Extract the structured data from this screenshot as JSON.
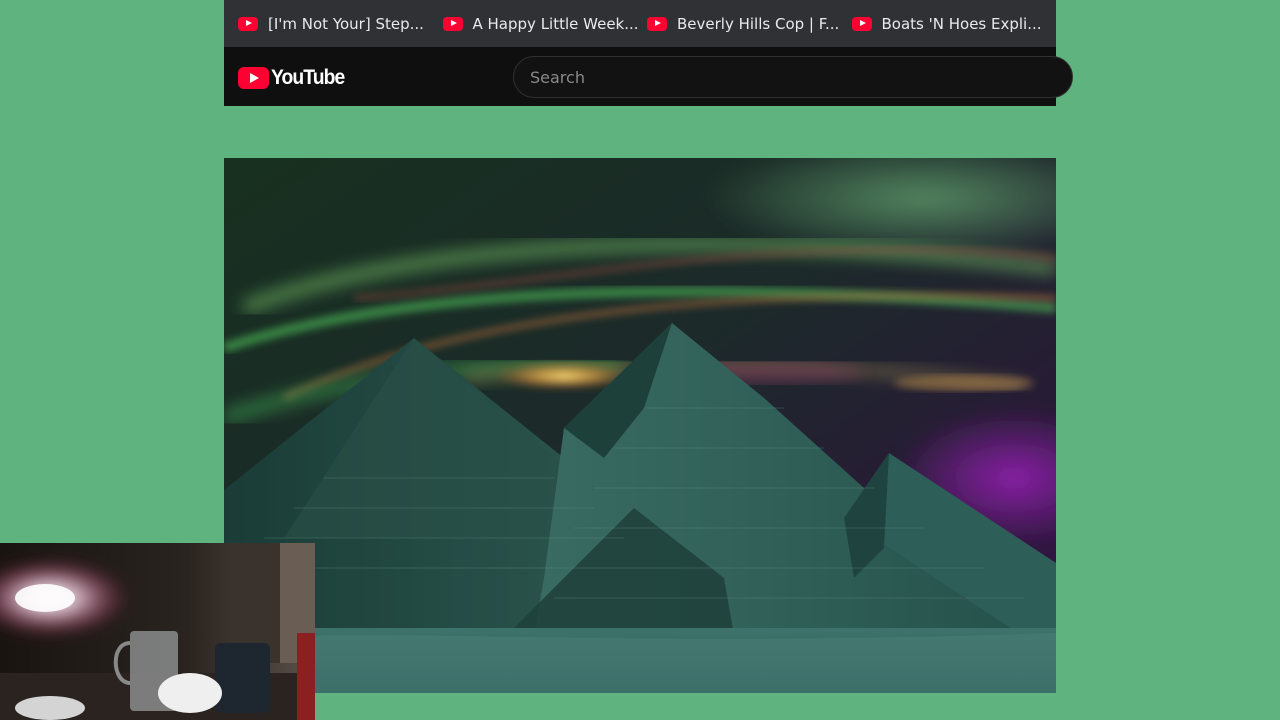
{
  "bookmarks": [
    {
      "label": "[I'm Not Your] Step...",
      "icon": "youtube-icon"
    },
    {
      "label": "A Happy Little Week...",
      "icon": "youtube-icon"
    },
    {
      "label": "Beverly Hills Cop | F...",
      "icon": "youtube-icon"
    },
    {
      "label": "Boats 'N Hoes Expli...",
      "icon": "youtube-icon"
    }
  ],
  "header": {
    "logo_text": "YouTube",
    "search_placeholder": "Search"
  },
  "colors": {
    "background": "#5fb37e",
    "bookmarks_bar": "#303134",
    "header": "#0f0f0f",
    "youtube_red": "#ff0033"
  }
}
